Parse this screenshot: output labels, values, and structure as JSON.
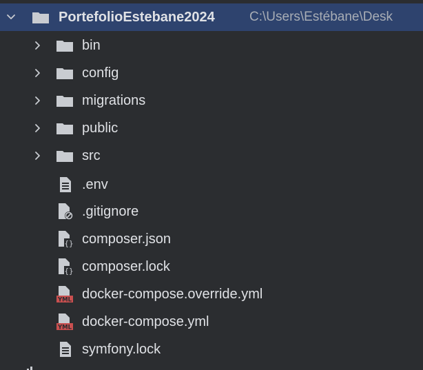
{
  "project": {
    "name": "PortefolioEstebane2024",
    "path": "C:\\Users\\Estébane\\Desk"
  },
  "folders": [
    {
      "label": "bin"
    },
    {
      "label": "config"
    },
    {
      "label": "migrations"
    },
    {
      "label": "public"
    },
    {
      "label": "src"
    }
  ],
  "files": [
    {
      "label": ".env",
      "icon": "text-file-icon"
    },
    {
      "label": ".gitignore",
      "icon": "ignore-file-icon"
    },
    {
      "label": "composer.json",
      "icon": "composer-file-icon"
    },
    {
      "label": "composer.lock",
      "icon": "composer-file-icon"
    },
    {
      "label": "docker-compose.override.yml",
      "icon": "yaml-file-icon"
    },
    {
      "label": "docker-compose.yml",
      "icon": "yaml-file-icon"
    },
    {
      "label": "symfony.lock",
      "icon": "text-file-icon"
    }
  ],
  "colors": {
    "background": "#2b2d30",
    "selection": "#2e436e",
    "folder": "#c9ccd1",
    "text": "#dfe1e5",
    "path_text": "#a8adb5",
    "yaml_badge": "#c94f4f"
  }
}
